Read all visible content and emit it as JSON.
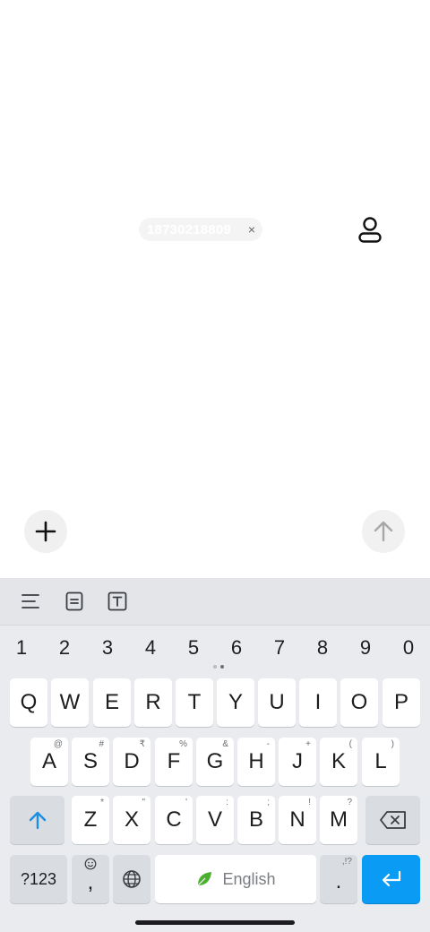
{
  "chip": {
    "text": "18730218809",
    "close": "×"
  },
  "profile": {
    "icon": "person-icon"
  },
  "actions": {
    "plus_icon": "plus-icon",
    "send_icon": "arrow-up-icon"
  },
  "toolbar": {
    "icons": [
      "align-left-icon",
      "clipboard-icon",
      "text-format-icon"
    ]
  },
  "number_row": [
    "1",
    "2",
    "3",
    "4",
    "5",
    "6",
    "7",
    "8",
    "9",
    "0"
  ],
  "row1": [
    {
      "key": "Q"
    },
    {
      "key": "W"
    },
    {
      "key": "E"
    },
    {
      "key": "R"
    },
    {
      "key": "T"
    },
    {
      "key": "Y"
    },
    {
      "key": "U"
    },
    {
      "key": "I"
    },
    {
      "key": "O"
    },
    {
      "key": "P"
    }
  ],
  "row2": [
    {
      "key": "A",
      "hint": "@"
    },
    {
      "key": "S",
      "hint": "#"
    },
    {
      "key": "D",
      "hint": "₹"
    },
    {
      "key": "F",
      "hint": "%"
    },
    {
      "key": "G",
      "hint": "&"
    },
    {
      "key": "H",
      "hint": "-"
    },
    {
      "key": "J",
      "hint": "+"
    },
    {
      "key": "K",
      "hint": "("
    },
    {
      "key": "L",
      "hint": ")"
    }
  ],
  "row3": [
    {
      "key": "Z",
      "hint": "*"
    },
    {
      "key": "X",
      "hint": "\""
    },
    {
      "key": "C",
      "hint": "'"
    },
    {
      "key": "V",
      "hint": ":"
    },
    {
      "key": "B",
      "hint": ";"
    },
    {
      "key": "N",
      "hint": "!"
    },
    {
      "key": "M",
      "hint": "?"
    }
  ],
  "bottom": {
    "symbols_label": "?123",
    "comma_label": ",",
    "space_label": "English",
    "period_label": ".",
    "period_hint": ",!?"
  },
  "colors": {
    "accent": "#0A9CF5",
    "shift": "#1A8FE3",
    "leaf": "#4CAF2F"
  }
}
